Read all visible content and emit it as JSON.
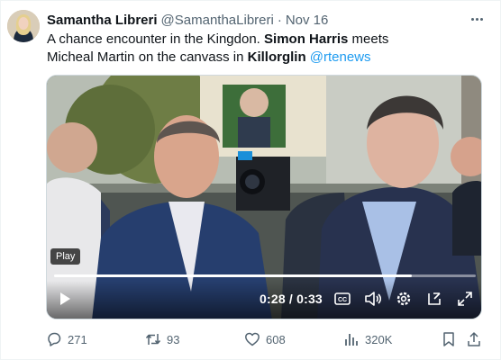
{
  "author": {
    "name": "Samantha Libreri",
    "handle": "@SamanthaLibreri",
    "separator": "·",
    "date": "Nov 16"
  },
  "tweet": {
    "line1_a": "A chance encounter in the Kingdon. ",
    "line1_b": "Simon Harris",
    "line1_c": " meets",
    "line2_a": "Micheal Martin on the canvass in ",
    "line2_b": "Killorglin",
    "line2_c": " ",
    "mention": "@rtenews"
  },
  "video": {
    "tooltip": "Play",
    "time": "0:28 / 0:33",
    "progress": 0.848,
    "icons": [
      "play-icon",
      "captions-icon",
      "volume-icon",
      "settings-icon",
      "popout-icon",
      "fullscreen-icon"
    ]
  },
  "actions": {
    "replies": "271",
    "reposts": "93",
    "likes": "608",
    "views": "320K"
  },
  "colors": {
    "accent": "#1d9bf0",
    "secondary_text": "#536471",
    "primary_text": "#0f1419"
  }
}
